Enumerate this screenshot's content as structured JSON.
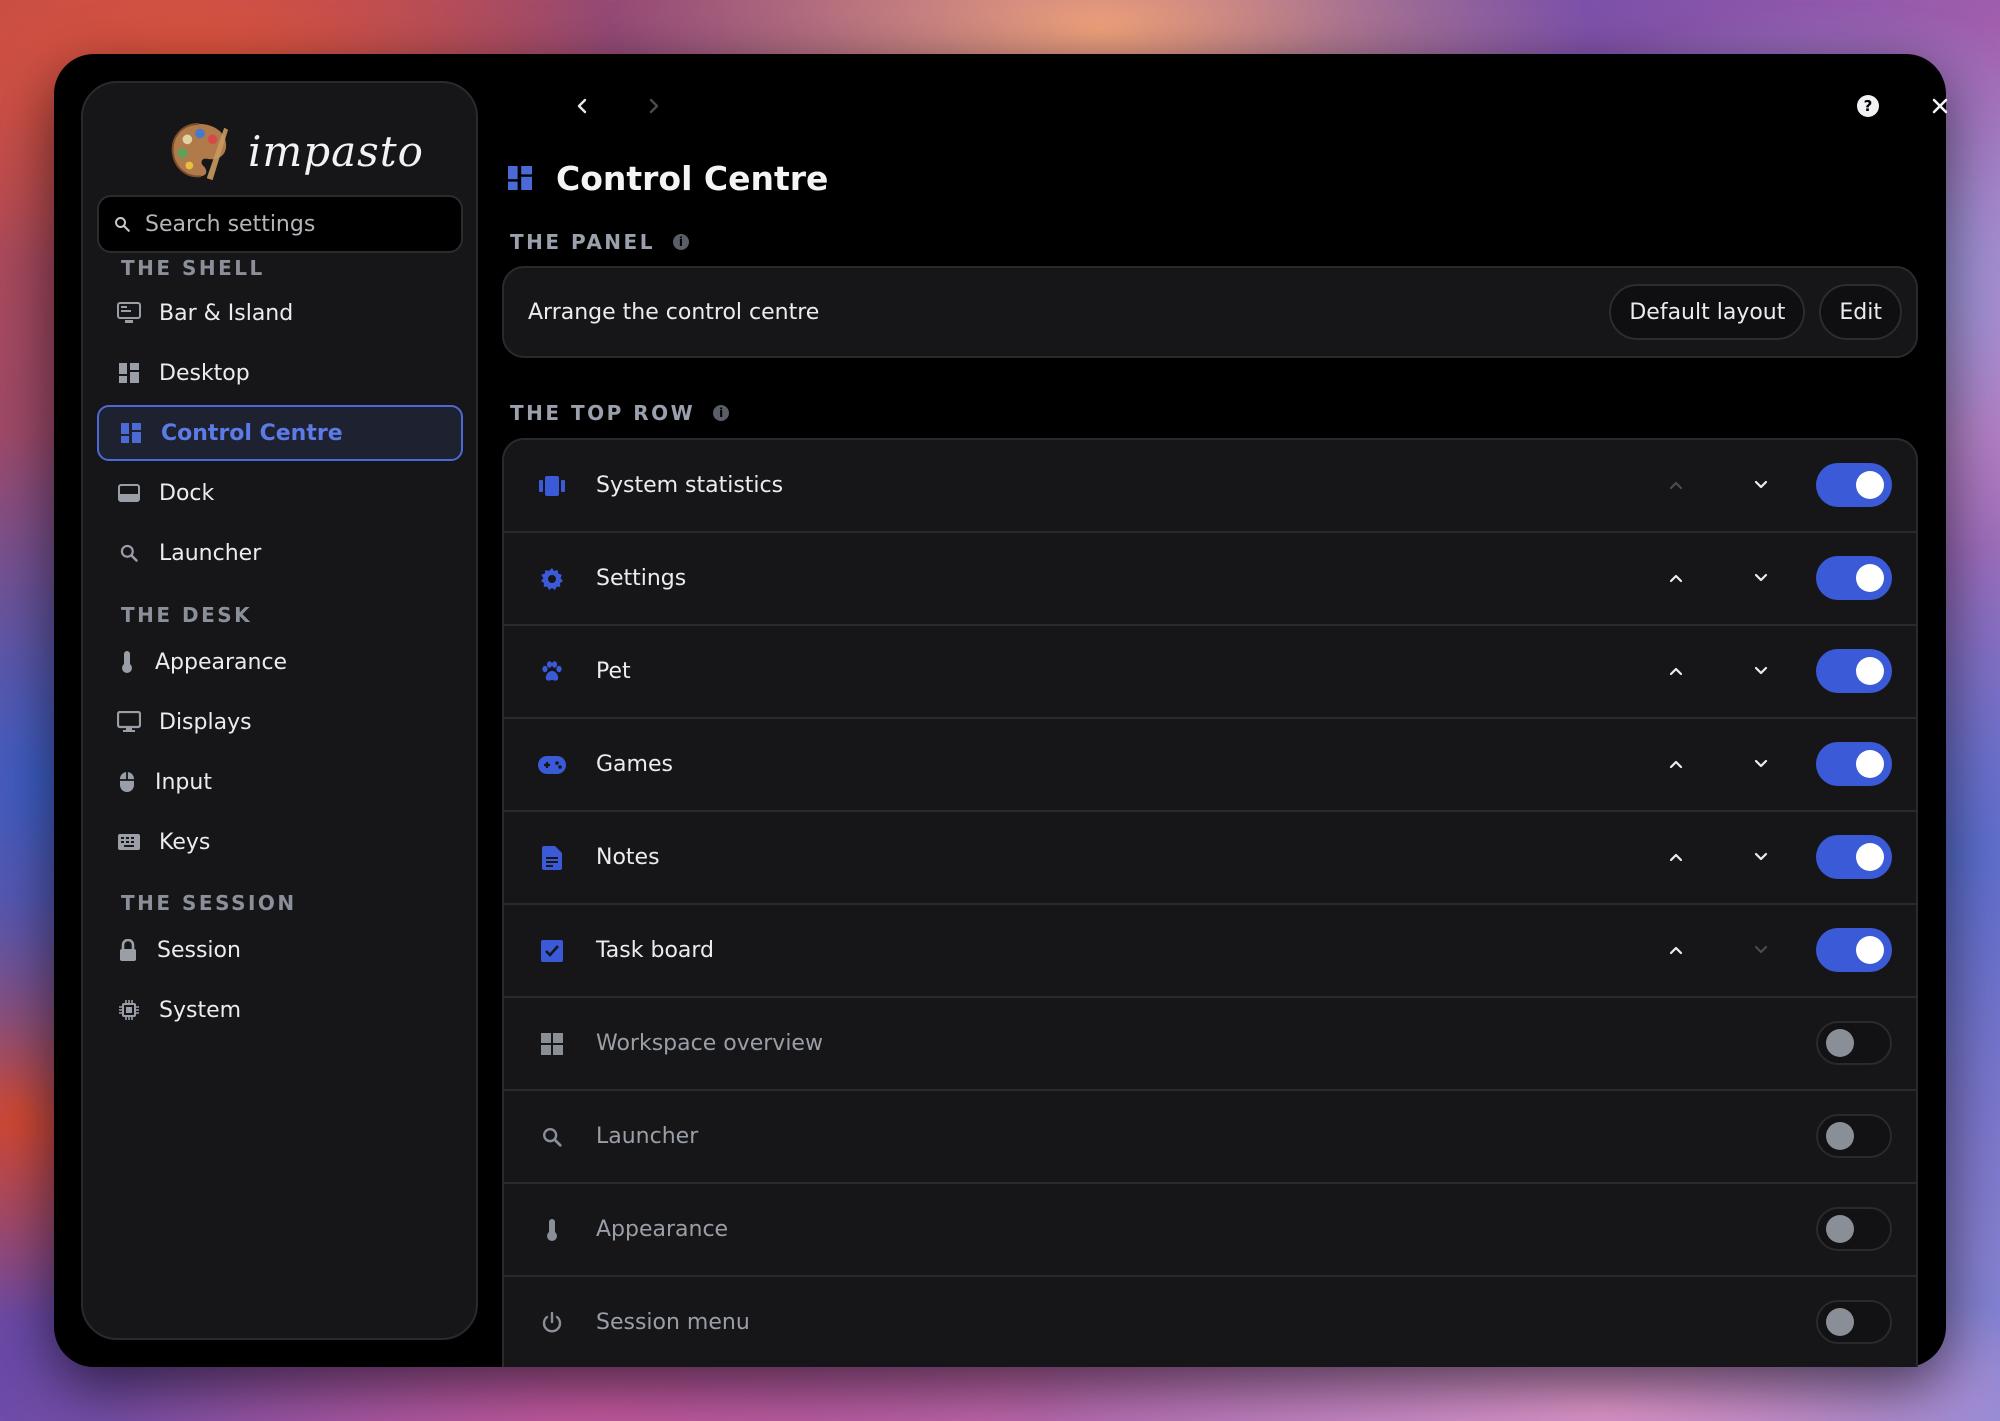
{
  "app": {
    "name": "impasto"
  },
  "search": {
    "placeholder": "Search settings"
  },
  "sidebar": {
    "sections": [
      {
        "label": "THE SHELL"
      },
      {
        "label": "THE DESK"
      },
      {
        "label": "THE SESSION"
      }
    ],
    "items": [
      {
        "label": "Bar & Island",
        "icon": "bar-island-icon"
      },
      {
        "label": "Desktop",
        "icon": "grid-icon"
      },
      {
        "label": "Control Centre",
        "icon": "grid-icon",
        "active": true
      },
      {
        "label": "Dock",
        "icon": "dock-icon"
      },
      {
        "label": "Launcher",
        "icon": "search-icon"
      },
      {
        "label": "Appearance",
        "icon": "thermometer-icon"
      },
      {
        "label": "Displays",
        "icon": "monitor-icon"
      },
      {
        "label": "Input",
        "icon": "mouse-icon"
      },
      {
        "label": "Keys",
        "icon": "keyboard-icon"
      },
      {
        "label": "Session",
        "icon": "lock-icon"
      },
      {
        "label": "System",
        "icon": "chip-icon"
      }
    ]
  },
  "page": {
    "title": "Control Centre",
    "panel_section": "THE PANEL",
    "panel_text": "Arrange the control centre",
    "default_layout_label": "Default layout",
    "edit_label": "Edit",
    "top_row_section": "THE TOP ROW"
  },
  "rows": [
    {
      "label": "System statistics",
      "icon": "stats-icon",
      "enabled": true,
      "up_enabled": false,
      "down_enabled": true
    },
    {
      "label": "Settings",
      "icon": "gear-icon",
      "enabled": true,
      "up_enabled": true,
      "down_enabled": true
    },
    {
      "label": "Pet",
      "icon": "paw-icon",
      "enabled": true,
      "up_enabled": true,
      "down_enabled": true
    },
    {
      "label": "Games",
      "icon": "gamepad-icon",
      "enabled": true,
      "up_enabled": true,
      "down_enabled": true
    },
    {
      "label": "Notes",
      "icon": "note-icon",
      "enabled": true,
      "up_enabled": true,
      "down_enabled": true
    },
    {
      "label": "Task board",
      "icon": "checkbox-icon",
      "enabled": true,
      "up_enabled": true,
      "down_enabled": false
    },
    {
      "label": "Workspace overview",
      "icon": "grid-icon",
      "enabled": false
    },
    {
      "label": "Launcher",
      "icon": "search-icon",
      "enabled": false
    },
    {
      "label": "Appearance",
      "icon": "thermometer-icon",
      "enabled": false
    },
    {
      "label": "Session menu",
      "icon": "power-icon",
      "enabled": false
    }
  ],
  "colors": {
    "accent": "#3a5ad8",
    "active_text": "#5c7be6",
    "background": "#000000",
    "card": "#161618"
  }
}
